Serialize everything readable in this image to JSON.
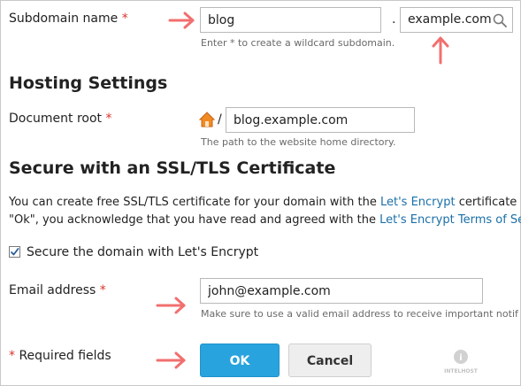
{
  "subdomain": {
    "label": "Subdomain name",
    "required_mark": "*",
    "value": "blog",
    "dot": ".",
    "domain_value": "example.com",
    "hint": "Enter * to create a wildcard subdomain."
  },
  "hosting": {
    "heading": "Hosting Settings",
    "docroot_label": "Document root",
    "required_mark": "*",
    "slash": "/",
    "docroot_value": "blog.example.com",
    "docroot_hint": "The path to the website home directory."
  },
  "ssl": {
    "heading": "Secure with an SSL/TLS Certificate",
    "para_line1_a": "You can create free SSL/TLS certificate for your domain with the ",
    "para_line1_link": "Let's Encrypt",
    "para_line1_b": " certificate a",
    "para_line2_a": "\"Ok\", you acknowledge that you have read and agreed with the ",
    "para_line2_link": "Let's Encrypt Terms of Se",
    "checkbox_label": "Secure the domain with Let's Encrypt",
    "checkbox_checked": true
  },
  "email": {
    "label": "Email address",
    "required_mark": "*",
    "value": "john@example.com",
    "hint": "Make sure to use a valid email address to receive important notif"
  },
  "footer": {
    "required_mark": "*",
    "required_text": "Required fields",
    "ok_label": "OK",
    "cancel_label": "Cancel",
    "watermark": "INTELHOST"
  },
  "colors": {
    "accent": "#29a3dd",
    "arrow": "#f26f6f",
    "required": "#d9342b",
    "link": "#1a6fa8"
  }
}
